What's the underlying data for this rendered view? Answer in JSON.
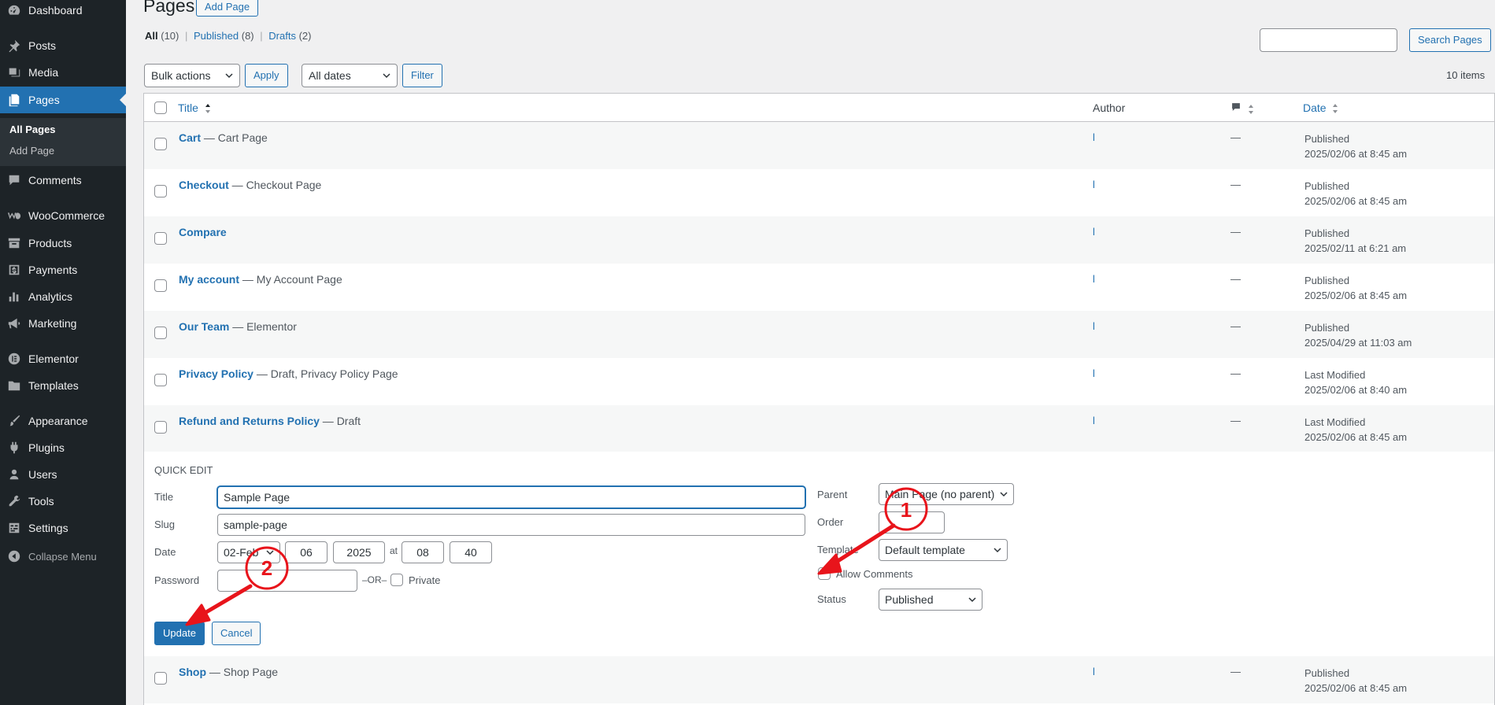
{
  "sidebar": {
    "items": [
      {
        "label": "Dashboard",
        "icon": "dashboard-icon"
      },
      {
        "label": "Posts",
        "icon": "pin-icon"
      },
      {
        "label": "Media",
        "icon": "media-icon"
      },
      {
        "label": "Pages",
        "icon": "pages-icon"
      },
      {
        "label": "Comments",
        "icon": "comment-icon"
      },
      {
        "label": "WooCommerce",
        "icon": "woocommerce-icon"
      },
      {
        "label": "Products",
        "icon": "archive-icon"
      },
      {
        "label": "Payments",
        "icon": "dollar-icon"
      },
      {
        "label": "Analytics",
        "icon": "chart-icon"
      },
      {
        "label": "Marketing",
        "icon": "megaphone-icon"
      },
      {
        "label": "Elementor",
        "icon": "elementor-icon"
      },
      {
        "label": "Templates",
        "icon": "folder-icon"
      },
      {
        "label": "Appearance",
        "icon": "brush-icon"
      },
      {
        "label": "Plugins",
        "icon": "plug-icon"
      },
      {
        "label": "Users",
        "icon": "user-icon"
      },
      {
        "label": "Tools",
        "icon": "wrench-icon"
      },
      {
        "label": "Settings",
        "icon": "settings-icon"
      }
    ],
    "submenu": {
      "all_pages": "All Pages",
      "add_page": "Add Page"
    },
    "collapse": "Collapse Menu",
    "active_color": "#2271b1"
  },
  "header": {
    "title": "Pages",
    "add_button": "Add Page"
  },
  "filters": {
    "all": "All",
    "all_count": "(10)",
    "published": "Published",
    "published_count": "(8)",
    "drafts": "Drafts",
    "drafts_count": "(2)",
    "sep": "|"
  },
  "search": {
    "button": "Search Pages",
    "value": ""
  },
  "toolbar": {
    "bulk_actions": "Bulk actions",
    "apply": "Apply",
    "dates": "All dates",
    "filter": "Filter",
    "items_count": "10 items"
  },
  "table": {
    "headers": {
      "title": "Title",
      "author": "Author",
      "date": "Date"
    },
    "rows": [
      {
        "title": "Cart",
        "state": " — Cart Page",
        "author": "l",
        "comments": "—",
        "status": "Published",
        "date": "2025/02/06 at 8:45 am"
      },
      {
        "title": "Checkout",
        "state": " — Checkout Page",
        "author": "l",
        "comments": "—",
        "status": "Published",
        "date": "2025/02/06 at 8:45 am"
      },
      {
        "title": "Compare",
        "state": "",
        "author": "l",
        "comments": "—",
        "status": "Published",
        "date": "2025/02/11 at 6:21 am"
      },
      {
        "title": "My account",
        "state": " — My Account Page",
        "author": "l",
        "comments": "—",
        "status": "Published",
        "date": "2025/02/06 at 8:45 am"
      },
      {
        "title": "Our Team",
        "state": " — Elementor",
        "author": "l",
        "comments": "—",
        "status": "Published",
        "date": "2025/04/29 at 11:03 am"
      },
      {
        "title": "Privacy Policy",
        "state": " — Draft, Privacy Policy Page",
        "author": "l",
        "comments": "—",
        "status": "Last Modified",
        "date": "2025/02/06 at 8:40 am"
      },
      {
        "title": "Refund and Returns Policy",
        "state": " — Draft",
        "author": "l",
        "comments": "—",
        "status": "Last Modified",
        "date": "2025/02/06 at 8:45 am"
      }
    ],
    "last_row": {
      "title": "Shop",
      "state": " — Shop Page",
      "author": "l",
      "comments": "—",
      "status": "Published",
      "date": "2025/02/06 at 8:45 am"
    }
  },
  "quick_edit": {
    "legend": "Quick Edit",
    "title_label": "Title",
    "title_value": "Sample Page",
    "slug_label": "Slug",
    "slug_value": "sample-page",
    "date_label": "Date",
    "month": "02-Feb",
    "day": "06",
    "year": "2025",
    "at": "at",
    "hour": "08",
    "minute": "40",
    "password_label": "Password",
    "or": "–OR–",
    "private": "Private",
    "parent_label": "Parent",
    "parent_value": "Main Page (no parent)",
    "order_label": "Order",
    "template_label": "Template",
    "template_value": "Default template",
    "allow_comments": "Allow Comments",
    "status_label": "Status",
    "status_value": "Published",
    "update": "Update",
    "cancel": "Cancel"
  },
  "annotations": {
    "marker1": "1",
    "marker2": "2",
    "color": "#e8141b"
  }
}
